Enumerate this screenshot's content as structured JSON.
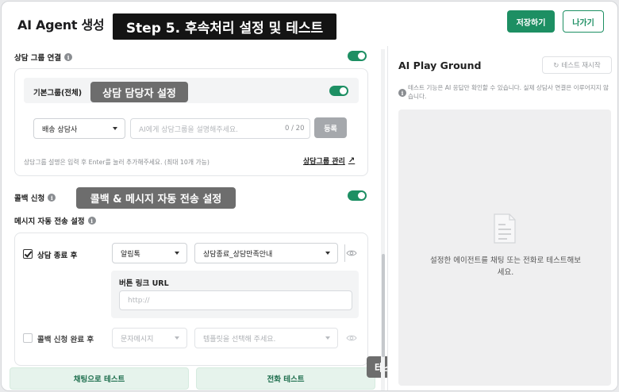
{
  "header": {
    "title": "AI Agent 생성",
    "step_banner": "Step 5. 후속처리 설정 및 테스트",
    "save_label": "저장하기",
    "exit_label": "나가기"
  },
  "consult_group": {
    "label": "상담 그룹 연결",
    "enabled": true,
    "default_group_title": "기본그룹(전체)",
    "default_group_enabled": true,
    "agent_select": "배송 상담사",
    "description_placeholder": "AI에게 상담그룹을 설명해주세요.",
    "counter": "0 / 20",
    "register_label": "등록",
    "hint": "상담그룹 설명은 입력 후 Enter를 눌러 추가해주세요. (최대 10개 가능)",
    "manage_link": "상담그룹 관리"
  },
  "callouts": {
    "agent_setting": "상담 담당자 설정",
    "callback_setting": "콜백 & 메시지 자동 전송 설정",
    "test": "테스트"
  },
  "callback": {
    "label": "콜백 신청",
    "enabled": true
  },
  "auto_message": {
    "label": "메시지 자동 전송 설정",
    "rows": [
      {
        "label": "상담 종료 후",
        "checked": true,
        "channel": "알림톡",
        "template": "상담종료_상담만족안내"
      },
      {
        "label": "콜백 신청 완료 후",
        "checked": false,
        "channel": "문자메시지",
        "template": "템플릿을 선택해 주세요."
      }
    ],
    "button_link_label": "버튼 링크 URL",
    "button_link_placeholder": "http://"
  },
  "bottom_buttons": {
    "chat_test": "채팅으로 테스트",
    "call_test": "전화 테스트"
  },
  "playground": {
    "title": "AI Play Ground",
    "retest_label": "테스트 재시작",
    "note": "테스트 기능은 AI 응답만 확인할 수 있습니다. 실제 상담사 연결은 이루어지지 않습니다.",
    "empty_line1": "설정한 에이전트를 채팅 또는 전화로 테스트해보",
    "empty_line2": "세요."
  },
  "colors": {
    "primary": "#1d8f63",
    "callout": "#6d6d6d",
    "banner": "#141414"
  },
  "icons": [
    "info-icon",
    "caret-down-icon",
    "external-arrow-icon",
    "eye-icon",
    "refresh-icon",
    "document-icon",
    "check-icon"
  ]
}
